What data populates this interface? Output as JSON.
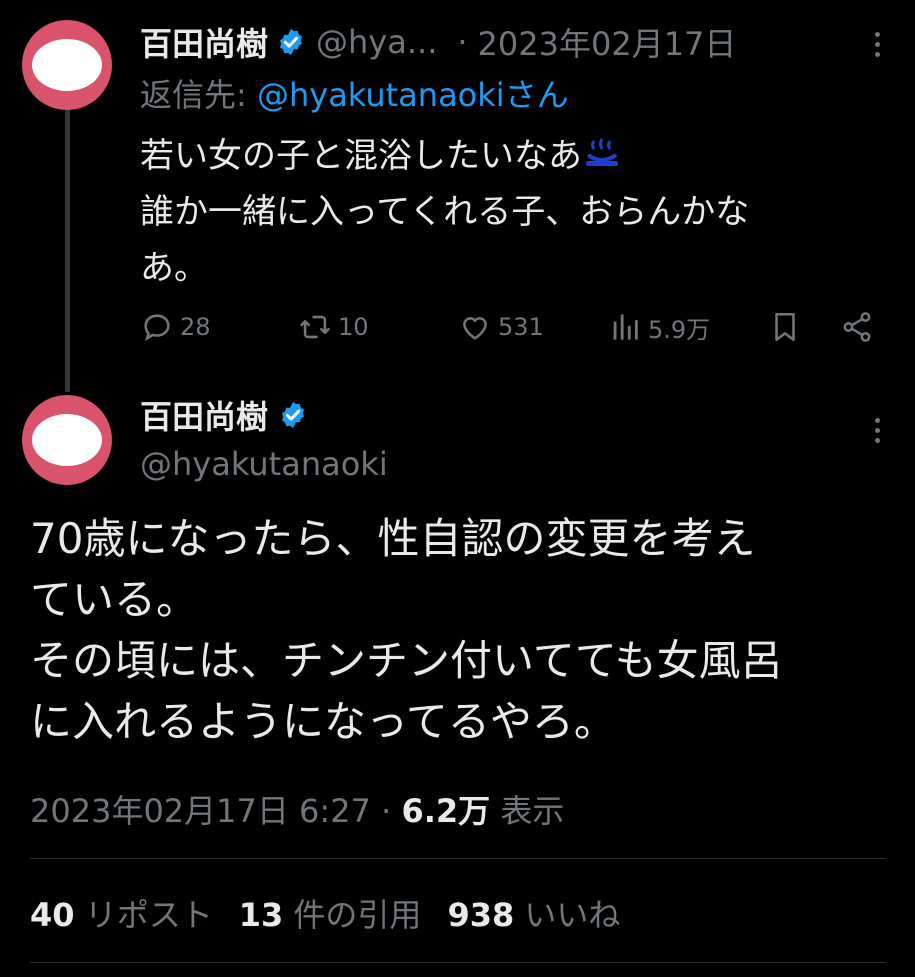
{
  "reply_tweet": {
    "author_name": "百田尚樹",
    "handle": "@hya...",
    "separator": "·",
    "date": "2023年02月17日",
    "reply_prefix": "返信先:",
    "reply_handle": "@hyakutanaoki",
    "reply_suffix": "さん",
    "body_line1": "若い女の子と混浴したいなあ",
    "body_line2": "誰か一緒に入ってくれる子、おらんかな",
    "body_line3": "あ。",
    "actions": {
      "replies": "28",
      "retweets": "10",
      "likes": "531",
      "views": "5.9万"
    }
  },
  "main_tweet": {
    "author_name": "百田尚樹",
    "handle": "@hyakutanaoki",
    "body_lines": [
      "70歳になったら、性自認の変更を考え",
      "ている。",
      "その頃には、チンチン付いてても女風呂",
      "に入れるようになってるやろ。"
    ],
    "timestamp": "2023年02月17日 6:27",
    "separator": "·",
    "views_count": "6.2万",
    "views_label": "表示",
    "stats": {
      "reposts_count": "40",
      "reposts_label": "リポスト",
      "quotes_count": "13",
      "quotes_label": "件の引用",
      "likes_count": "938",
      "likes_label": "いいね"
    }
  },
  "colors": {
    "background": "#000000",
    "text": "#e7e9ea",
    "muted": "#71767b",
    "accent": "#1d9bf0",
    "avatar": "#d9536b"
  },
  "icons": [
    "verified-badge-icon",
    "more-icon",
    "reply-icon",
    "retweet-icon",
    "like-icon",
    "views-icon",
    "bookmark-icon",
    "share-icon",
    "hot-spring-emoji-icon"
  ]
}
